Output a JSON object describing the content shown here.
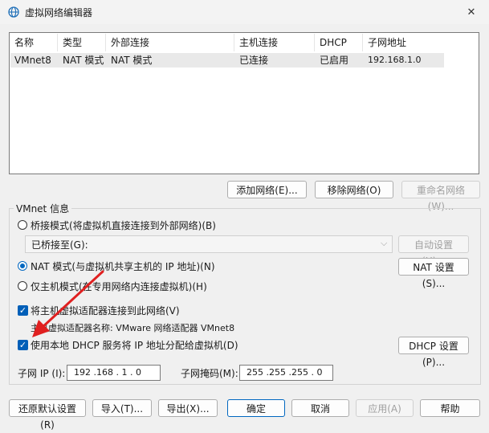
{
  "window": {
    "title": "虚拟网络编辑器"
  },
  "table": {
    "columns": [
      "名称",
      "类型",
      "外部连接",
      "主机连接",
      "DHCP",
      "子网地址"
    ],
    "rows": [
      [
        "VMnet8",
        "NAT 模式",
        "NAT 模式",
        "已连接",
        "已启用",
        "192.168.1.0"
      ]
    ]
  },
  "table_buttons": {
    "add": "添加网络(E)...",
    "remove": "移除网络(O)",
    "rename": "重命名网络(W)..."
  },
  "vmnet_info": {
    "label": "VMnet 信息",
    "bridged_radio": "桥接模式(将虚拟机直接连接到外部网络)(B)",
    "bridged_to_label": "已桥接至(G):",
    "auto_settings": "自动设置(U)...",
    "nat_radio": "NAT 模式(与虚拟机共享主机的 IP 地址)(N)",
    "nat_settings": "NAT 设置(S)...",
    "hostonly_radio": "仅主机模式(在专用网络内连接虚拟机)(H)",
    "connect_adapter_check": "将主机虚拟适配器连接到此网络(V)",
    "adapter_name": "主机虚拟适配器名称: VMware 网络适配器 VMnet8",
    "dhcp_check": "使用本地 DHCP 服务将 IP 地址分配给虚拟机(D)",
    "dhcp_settings": "DHCP 设置(P)...",
    "subnet_ip_label": "子网 IP (I):",
    "subnet_ip": "192 .168 . 1 . 0",
    "subnet_mask_label": "子网掩码(M):",
    "subnet_mask": "255 .255 .255 . 0"
  },
  "footer": {
    "restore": "还原默认设置(R)",
    "import": "导入(T)...",
    "export": "导出(X)...",
    "ok": "确定",
    "cancel": "取消",
    "apply": "应用(A)",
    "help": "帮助"
  },
  "colors": {
    "accent": "#0067c0",
    "annotation_arrow": "#e02020"
  }
}
